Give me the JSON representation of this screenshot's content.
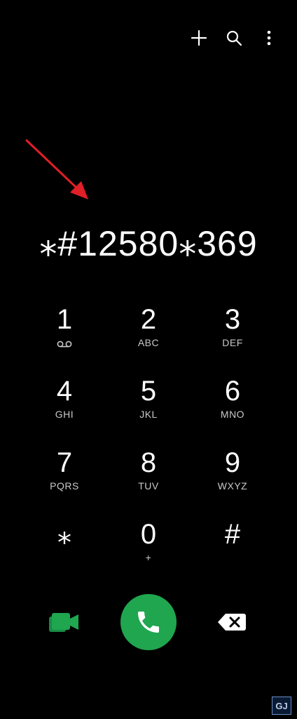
{
  "top_bar": {
    "icons": [
      "plus-icon",
      "search-icon",
      "more-vert-icon"
    ]
  },
  "dialer": {
    "entered_number": "⁎#12580⁎369"
  },
  "keys": [
    {
      "digit": "1",
      "letters": ""
    },
    {
      "digit": "2",
      "letters": "ABC"
    },
    {
      "digit": "3",
      "letters": "DEF"
    },
    {
      "digit": "4",
      "letters": "GHI"
    },
    {
      "digit": "5",
      "letters": "JKL"
    },
    {
      "digit": "6",
      "letters": "MNO"
    },
    {
      "digit": "7",
      "letters": "PQRS"
    },
    {
      "digit": "8",
      "letters": "TUV"
    },
    {
      "digit": "9",
      "letters": "WXYZ"
    },
    {
      "digit": "⁎",
      "letters": ""
    },
    {
      "digit": "0",
      "letters": "+"
    },
    {
      "digit": "#",
      "letters": ""
    }
  ],
  "bottom_bar": {
    "video_icon": "video-call-icon",
    "call_icon": "phone-icon",
    "backspace_icon": "backspace-icon"
  },
  "colors": {
    "background": "#000000",
    "call_green": "#1fa64f",
    "video_green": "#1fa64f",
    "arrow_red": "#e01f26"
  },
  "watermark": {
    "text": "GJ"
  }
}
